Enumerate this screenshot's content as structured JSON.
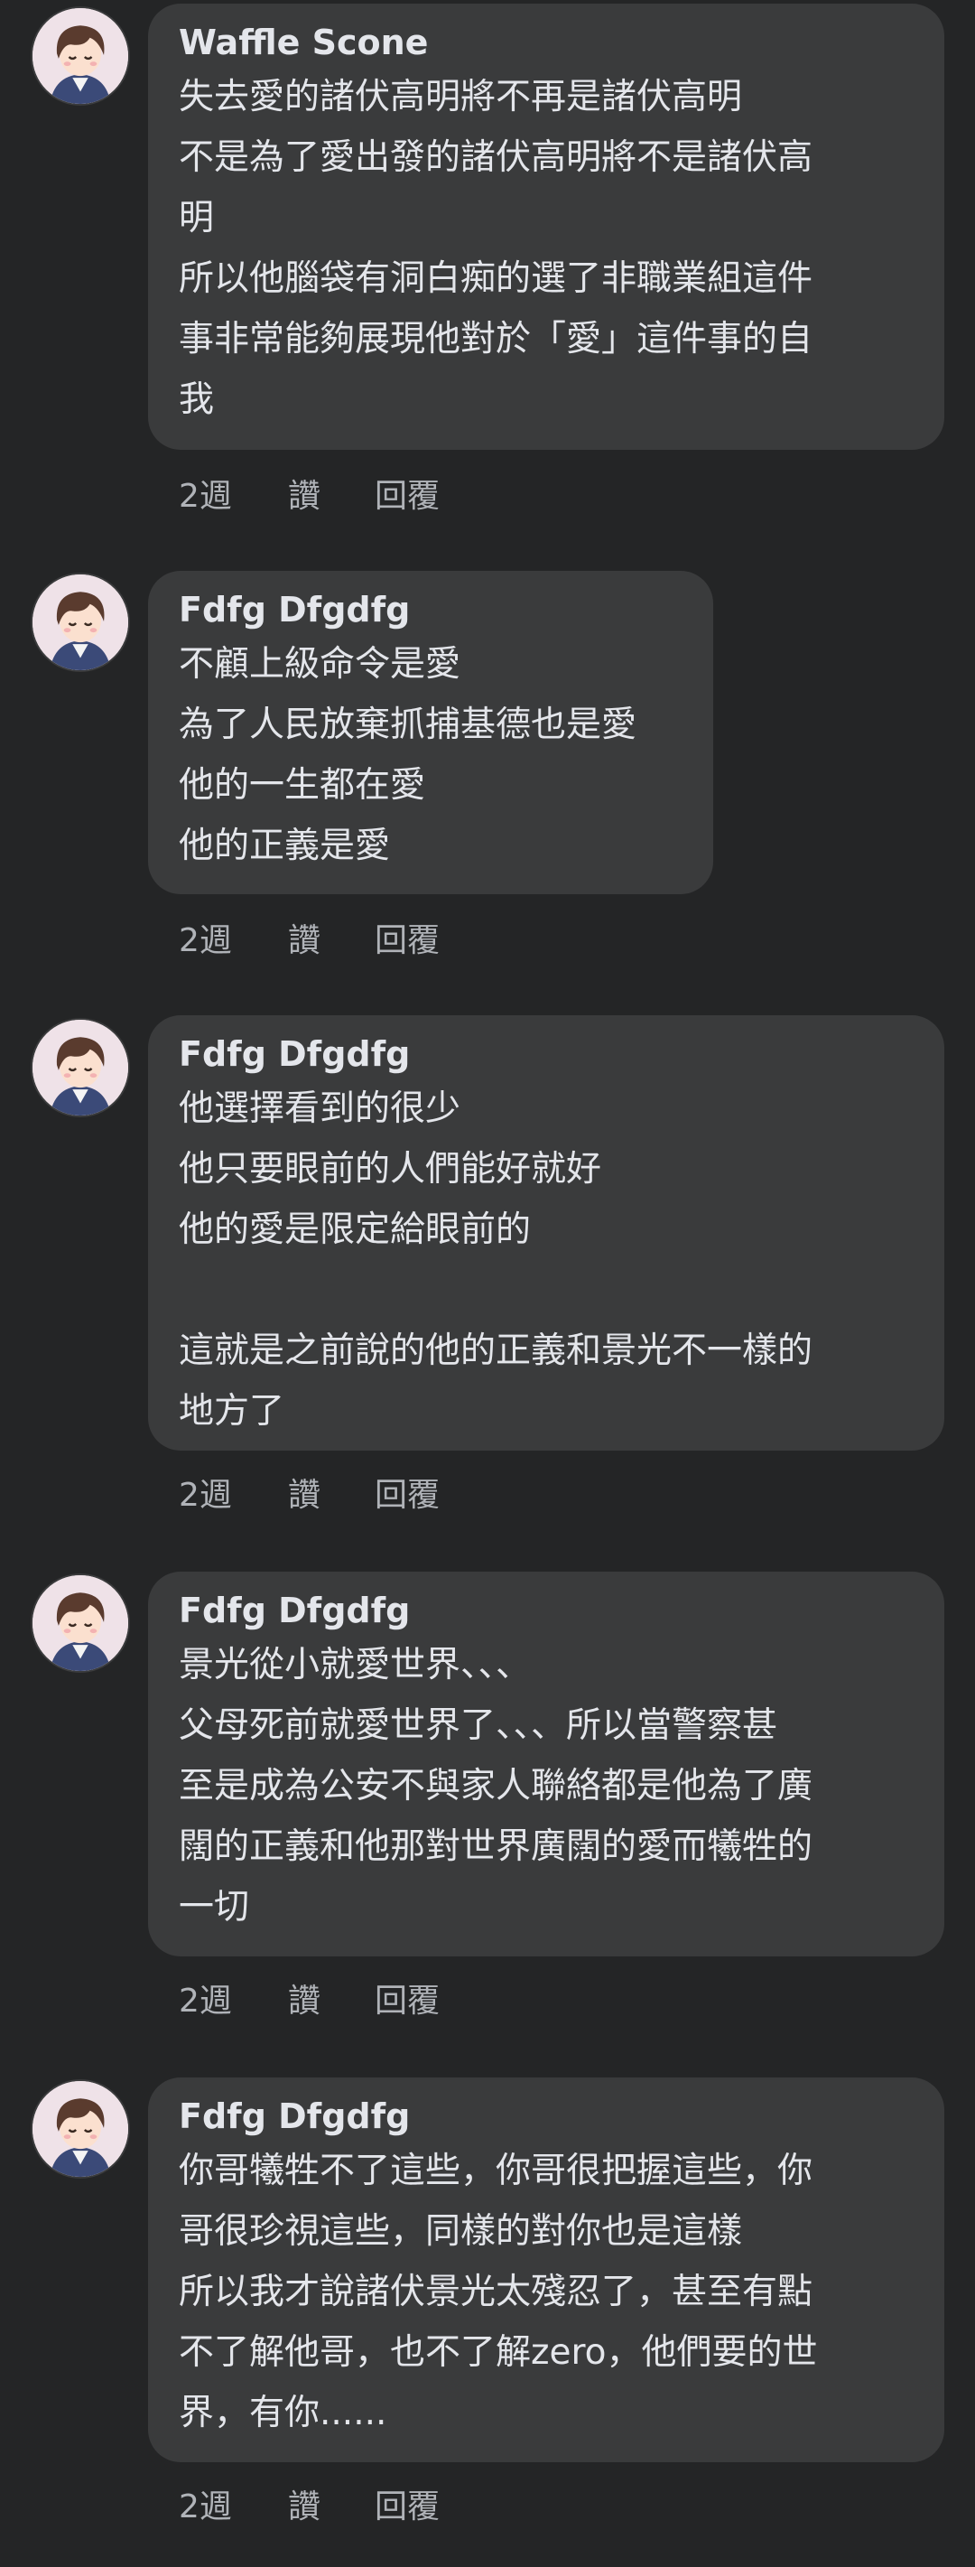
{
  "comments": [
    {
      "author": "Waffle Scone",
      "lines": "失去愛的諸伏高明將不再是諸伏高明\n不是為了愛出發的諸伏高明將不是諸伏高\n明\n所以他腦袋有洞白痴的選了非職業組這件\n事非常能夠展現他對於「愛」這件事的自\n我",
      "time": "2週",
      "like": "讚",
      "reply": "回覆"
    },
    {
      "author": "Fdfg Dfgdfg",
      "lines": "不顧上級命令是愛\n為了人民放棄抓捕基德也是愛\n他的一生都在愛\n他的正義是愛",
      "time": "2週",
      "like": "讚",
      "reply": "回覆"
    },
    {
      "author": "Fdfg Dfgdfg",
      "lines": "他選擇看到的很少\n他只要眼前的人們能好就好\n他的愛是限定給眼前的\n\n這就是之前說的他的正義和景光不一樣的\n地方了",
      "time": "2週",
      "like": "讚",
      "reply": "回覆"
    },
    {
      "author": "Fdfg Dfgdfg",
      "lines": "景光從小就愛世界、、、\n父母死前就愛世界了、、、所以當警察甚\n至是成為公安不與家人聯絡都是他為了廣\n闊的正義和他那對世界廣闊的愛而犧牲的\n一切",
      "time": "2週",
      "like": "讚",
      "reply": "回覆"
    },
    {
      "author": "Fdfg Dfgdfg",
      "lines": "你哥犧牲不了這些，你哥很把握這些，你\n哥很珍視這些，同樣的對你也是這樣\n所以我才說諸伏景光太殘忍了，甚至有點\n不了解他哥，也不了解zero，他們要的世\n界，有你......",
      "time": "2週",
      "like": "讚",
      "reply": "回覆"
    }
  ]
}
